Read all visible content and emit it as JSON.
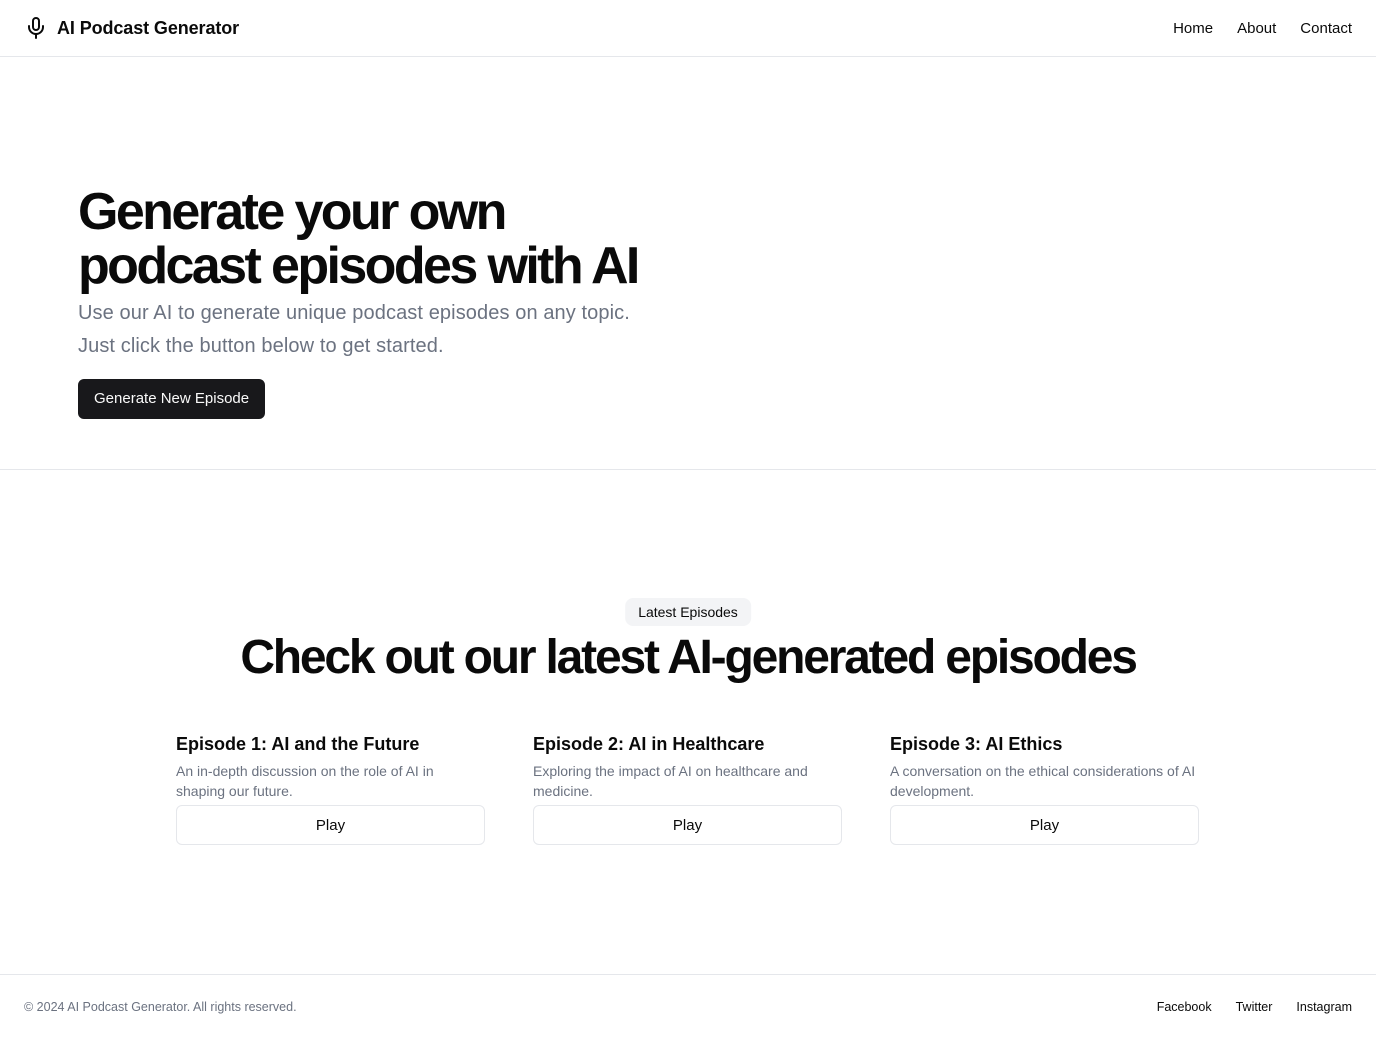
{
  "header": {
    "brand": "AI Podcast Generator",
    "brand_icon": "microphone-icon",
    "nav": [
      {
        "label": "Home"
      },
      {
        "label": "About"
      },
      {
        "label": "Contact"
      }
    ]
  },
  "hero": {
    "title": "Generate your own podcast episodes with AI",
    "subtitle": "Use our AI to generate unique podcast episodes on any topic. Just click the button below to get started.",
    "cta_label": "Generate New Episode"
  },
  "episodes": {
    "badge": "Latest Episodes",
    "title": "Check out our latest AI-generated episodes",
    "items": [
      {
        "title": "Episode 1: AI and the Future",
        "description": "An in-depth discussion on the role of AI in shaping our future.",
        "button": "Play"
      },
      {
        "title": "Episode 2: AI in Healthcare",
        "description": "Exploring the impact of AI on healthcare and medicine.",
        "button": "Play"
      },
      {
        "title": "Episode 3: AI Ethics",
        "description": "A conversation on the ethical considerations of AI development.",
        "button": "Play"
      }
    ]
  },
  "footer": {
    "copyright": "© 2024 AI Podcast Generator. All rights reserved.",
    "links": [
      {
        "label": "Facebook"
      },
      {
        "label": "Twitter"
      },
      {
        "label": "Instagram"
      }
    ]
  },
  "colors": {
    "text": "#0a0a0a",
    "muted": "#6b7280",
    "primary_button": "#18181b",
    "border": "#e5e7eb",
    "badge_bg": "#f3f4f6"
  }
}
